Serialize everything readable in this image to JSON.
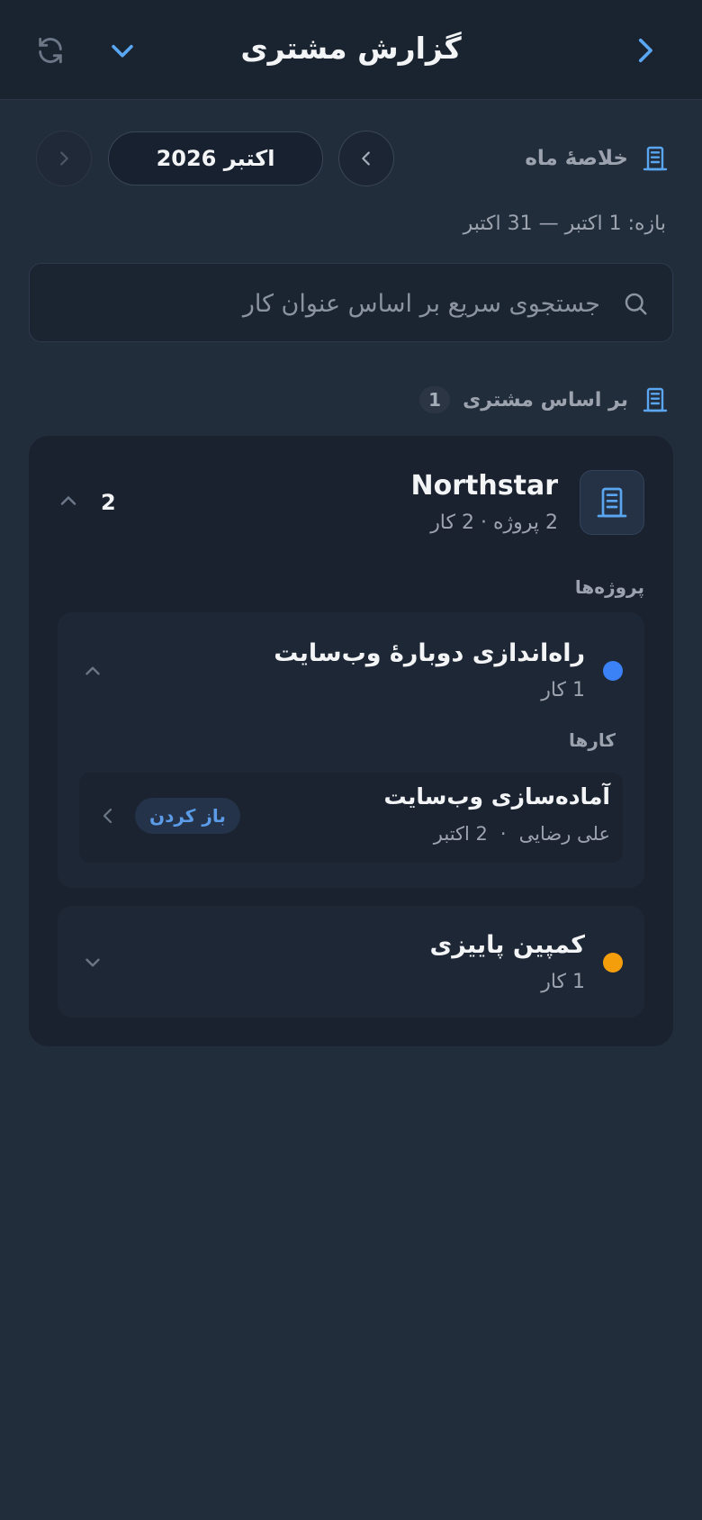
{
  "header": {
    "title": "گزارش مشتری",
    "icons": [
      "back-chevron-icon",
      "dropdown-chevron-icon",
      "refresh-icon"
    ],
    "accent": "#5aa6f0"
  },
  "month_nav": {
    "summary_label": "خلاصهٔ ماه",
    "current_month": "اکتبر 2026",
    "range": "بازه: 1 اکتبر — 31 اکتبر"
  },
  "search": {
    "placeholder": "جستجوی سریع بر اساس عنوان کار",
    "value": ""
  },
  "by_client": {
    "label": "بر اساس مشتری",
    "count": "1"
  },
  "client": {
    "name": "Northstar",
    "meta": "2 پروژه · 2 کار",
    "total": "2",
    "projects_label": "پروژه‌ها",
    "projects": [
      {
        "title": "راه‌اندازی دوبارهٔ وب‌سایت",
        "meta": "1 کار",
        "color": "#3b82f6",
        "expanded": true,
        "tasks_label": "کارها",
        "tasks": [
          {
            "title": "آماده‌سازی وب‌سایت",
            "assignee": "علی رضایی",
            "separator": "·",
            "date": "2 اکتبر",
            "action": "باز کردن"
          }
        ]
      },
      {
        "title": "کمپین پاییزی",
        "meta": "1 کار",
        "color": "#f59e0b",
        "expanded": false
      }
    ]
  }
}
